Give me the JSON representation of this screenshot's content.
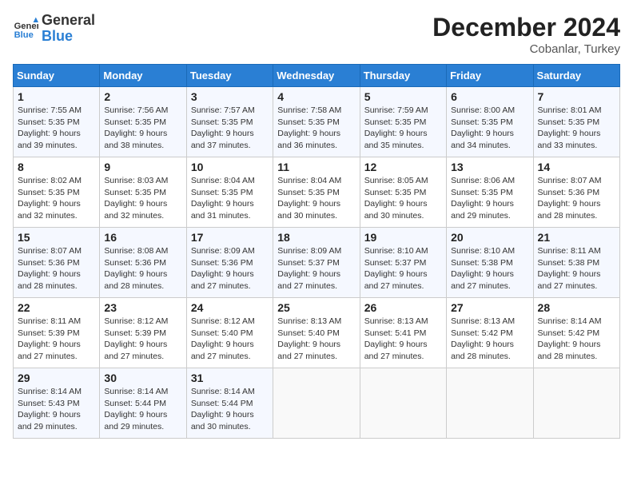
{
  "header": {
    "logo_line1": "General",
    "logo_line2": "Blue",
    "month": "December 2024",
    "location": "Cobanlar, Turkey"
  },
  "days_of_week": [
    "Sunday",
    "Monday",
    "Tuesday",
    "Wednesday",
    "Thursday",
    "Friday",
    "Saturday"
  ],
  "weeks": [
    [
      {
        "num": "1",
        "sunrise": "7:55 AM",
        "sunset": "5:35 PM",
        "daylight": "9 hours and 39 minutes."
      },
      {
        "num": "2",
        "sunrise": "7:56 AM",
        "sunset": "5:35 PM",
        "daylight": "9 hours and 38 minutes."
      },
      {
        "num": "3",
        "sunrise": "7:57 AM",
        "sunset": "5:35 PM",
        "daylight": "9 hours and 37 minutes."
      },
      {
        "num": "4",
        "sunrise": "7:58 AM",
        "sunset": "5:35 PM",
        "daylight": "9 hours and 36 minutes."
      },
      {
        "num": "5",
        "sunrise": "7:59 AM",
        "sunset": "5:35 PM",
        "daylight": "9 hours and 35 minutes."
      },
      {
        "num": "6",
        "sunrise": "8:00 AM",
        "sunset": "5:35 PM",
        "daylight": "9 hours and 34 minutes."
      },
      {
        "num": "7",
        "sunrise": "8:01 AM",
        "sunset": "5:35 PM",
        "daylight": "9 hours and 33 minutes."
      }
    ],
    [
      {
        "num": "8",
        "sunrise": "8:02 AM",
        "sunset": "5:35 PM",
        "daylight": "9 hours and 32 minutes."
      },
      {
        "num": "9",
        "sunrise": "8:03 AM",
        "sunset": "5:35 PM",
        "daylight": "9 hours and 32 minutes."
      },
      {
        "num": "10",
        "sunrise": "8:04 AM",
        "sunset": "5:35 PM",
        "daylight": "9 hours and 31 minutes."
      },
      {
        "num": "11",
        "sunrise": "8:04 AM",
        "sunset": "5:35 PM",
        "daylight": "9 hours and 30 minutes."
      },
      {
        "num": "12",
        "sunrise": "8:05 AM",
        "sunset": "5:35 PM",
        "daylight": "9 hours and 30 minutes."
      },
      {
        "num": "13",
        "sunrise": "8:06 AM",
        "sunset": "5:35 PM",
        "daylight": "9 hours and 29 minutes."
      },
      {
        "num": "14",
        "sunrise": "8:07 AM",
        "sunset": "5:36 PM",
        "daylight": "9 hours and 28 minutes."
      }
    ],
    [
      {
        "num": "15",
        "sunrise": "8:07 AM",
        "sunset": "5:36 PM",
        "daylight": "9 hours and 28 minutes."
      },
      {
        "num": "16",
        "sunrise": "8:08 AM",
        "sunset": "5:36 PM",
        "daylight": "9 hours and 28 minutes."
      },
      {
        "num": "17",
        "sunrise": "8:09 AM",
        "sunset": "5:36 PM",
        "daylight": "9 hours and 27 minutes."
      },
      {
        "num": "18",
        "sunrise": "8:09 AM",
        "sunset": "5:37 PM",
        "daylight": "9 hours and 27 minutes."
      },
      {
        "num": "19",
        "sunrise": "8:10 AM",
        "sunset": "5:37 PM",
        "daylight": "9 hours and 27 minutes."
      },
      {
        "num": "20",
        "sunrise": "8:10 AM",
        "sunset": "5:38 PM",
        "daylight": "9 hours and 27 minutes."
      },
      {
        "num": "21",
        "sunrise": "8:11 AM",
        "sunset": "5:38 PM",
        "daylight": "9 hours and 27 minutes."
      }
    ],
    [
      {
        "num": "22",
        "sunrise": "8:11 AM",
        "sunset": "5:39 PM",
        "daylight": "9 hours and 27 minutes."
      },
      {
        "num": "23",
        "sunrise": "8:12 AM",
        "sunset": "5:39 PM",
        "daylight": "9 hours and 27 minutes."
      },
      {
        "num": "24",
        "sunrise": "8:12 AM",
        "sunset": "5:40 PM",
        "daylight": "9 hours and 27 minutes."
      },
      {
        "num": "25",
        "sunrise": "8:13 AM",
        "sunset": "5:40 PM",
        "daylight": "9 hours and 27 minutes."
      },
      {
        "num": "26",
        "sunrise": "8:13 AM",
        "sunset": "5:41 PM",
        "daylight": "9 hours and 27 minutes."
      },
      {
        "num": "27",
        "sunrise": "8:13 AM",
        "sunset": "5:42 PM",
        "daylight": "9 hours and 28 minutes."
      },
      {
        "num": "28",
        "sunrise": "8:14 AM",
        "sunset": "5:42 PM",
        "daylight": "9 hours and 28 minutes."
      }
    ],
    [
      {
        "num": "29",
        "sunrise": "8:14 AM",
        "sunset": "5:43 PM",
        "daylight": "9 hours and 29 minutes."
      },
      {
        "num": "30",
        "sunrise": "8:14 AM",
        "sunset": "5:44 PM",
        "daylight": "9 hours and 29 minutes."
      },
      {
        "num": "31",
        "sunrise": "8:14 AM",
        "sunset": "5:44 PM",
        "daylight": "9 hours and 30 minutes."
      },
      null,
      null,
      null,
      null
    ]
  ]
}
